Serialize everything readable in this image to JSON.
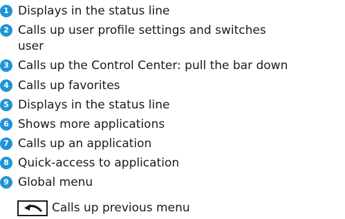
{
  "accent_color": "#1f93d6",
  "items": [
    {
      "number": "1",
      "text": "Displays in the status line"
    },
    {
      "number": "2",
      "text": "Calls up user profile settings and switches user"
    },
    {
      "number": "3",
      "text": "Calls up the Control Center: pull the bar down"
    },
    {
      "number": "4",
      "text": "Calls up favorites"
    },
    {
      "number": "5",
      "text": "Displays in the status line"
    },
    {
      "number": "6",
      "text": "Shows more applications"
    },
    {
      "number": "7",
      "text": "Calls up an application"
    },
    {
      "number": "8",
      "text": "Quick-access to application"
    },
    {
      "number": "9",
      "text": "Global menu"
    }
  ],
  "sub_item": {
    "icon": "back-arrow-icon",
    "text": "Calls up previous menu"
  }
}
